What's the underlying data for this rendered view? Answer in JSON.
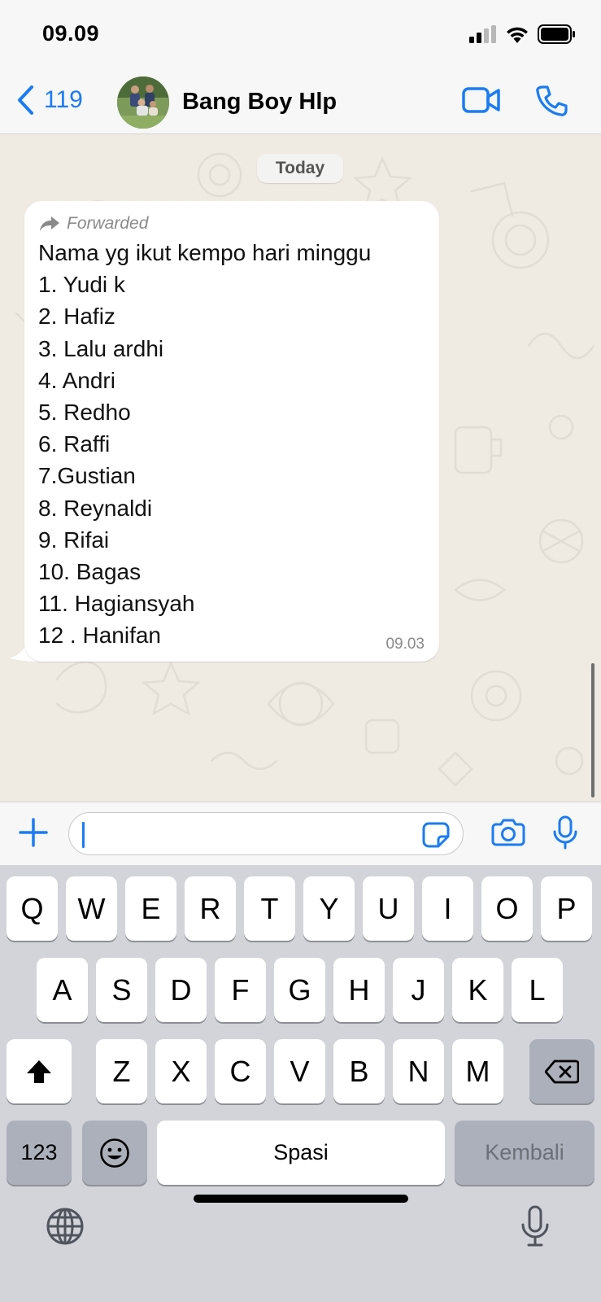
{
  "status_bar": {
    "time": "09.09"
  },
  "header": {
    "back_count": "119",
    "contact_name": "Bang Boy Hlp",
    "icons": [
      "chevron-left-icon",
      "video-call-icon",
      "phone-icon"
    ]
  },
  "chat": {
    "date_label": "Today",
    "message": {
      "forwarded_label": "Forwarded",
      "lines": [
        "Nama yg ikut kempo hari minggu",
        "1. Yudi k",
        "2. Hafiz",
        "3. Lalu ardhi",
        "4. Andri",
        "5. Redho",
        "6. Raffi",
        "7.Gustian",
        "8. Reynaldi",
        "9. Rifai",
        "10. Bagas",
        "11. Hagiansyah",
        "12 . Hanifan"
      ],
      "time": "09.03"
    }
  },
  "composer": {
    "icons": [
      "plus-icon",
      "sticker-icon",
      "camera-icon",
      "microphone-icon"
    ]
  },
  "keyboard": {
    "row1": [
      "Q",
      "W",
      "E",
      "R",
      "T",
      "Y",
      "U",
      "I",
      "O",
      "P"
    ],
    "row2": [
      "A",
      "S",
      "D",
      "F",
      "G",
      "H",
      "J",
      "K",
      "L"
    ],
    "row3": [
      "Z",
      "X",
      "C",
      "V",
      "B",
      "N",
      "M"
    ],
    "numbers_label": "123",
    "space_label": "Spasi",
    "return_label": "Kembali"
  },
  "colors": {
    "accent": "#1a7cf3",
    "chat_background": "#efeae2",
    "bubble": "#ffffff",
    "keyboard": "#d2d4da"
  }
}
